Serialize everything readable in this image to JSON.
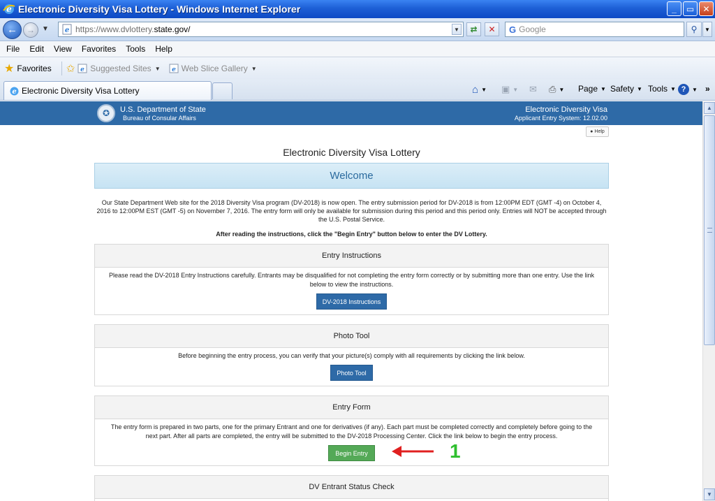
{
  "window": {
    "title": "Electronic Diversity Visa Lottery - Windows Internet Explorer",
    "buttons": {
      "minimize": "_",
      "maximize": "▭",
      "close": "✕"
    }
  },
  "address": {
    "url_scheme": "https://www.dvlottery.",
    "url_host": "state.gov/",
    "search_placeholder": "Google"
  },
  "menu": [
    "File",
    "Edit",
    "View",
    "Favorites",
    "Tools",
    "Help"
  ],
  "favorites": {
    "label": "Favorites",
    "links": [
      "Suggested Sites",
      "Web Slice Gallery"
    ]
  },
  "tabs": {
    "active_label": "Electronic Diversity Visa Lottery"
  },
  "commands": {
    "page": "Page",
    "safety": "Safety",
    "tools": "Tools",
    "more": "»"
  },
  "site": {
    "dept": "U.S. Department of State",
    "bureau": "Bureau of Consular Affairs",
    "system": "Electronic Diversity Visa",
    "system_version": "Applicant Entry System: 12.02.00",
    "help_label": "Help",
    "page_title": "Electronic Diversity Visa Lottery",
    "welcome": "Welcome",
    "intro": "Our State Department Web site for the 2018 Diversity Visa program (DV-2018) is now open. The entry submission period for DV-2018 is from 12:00PM EDT (GMT -4) on October 4, 2016 to 12:00PM EST (GMT -5) on November 7, 2016. The entry form will only be available for submission during this period and this period only. Entries will NOT be accepted through the U.S. Postal Service.",
    "intro_bold": "After reading the instructions, click the \"Begin Entry\" button below to enter the DV Lottery."
  },
  "panels": {
    "instructions": {
      "title": "Entry Instructions",
      "body": "Please read the DV-2018 Entry Instructions carefully. Entrants may be disqualified for not completing the entry form correctly or by submitting more than one entry. Use the link below to view the instructions.",
      "button": "DV-2018 Instructions"
    },
    "photo": {
      "title": "Photo Tool",
      "body": "Before beginning the entry process, you can verify that your picture(s) comply with all requirements by clicking the link below.",
      "button": "Photo Tool"
    },
    "entry": {
      "title": "Entry Form",
      "body": "The entry form is prepared in two parts, one for the primary Entrant and one for derivatives (if any). Each part must be completed correctly and completely before going to the next part. After all parts are completed, the entry will be submitted to the DV-2018 Processing Center. Click the link below to begin the entry process.",
      "button": "Begin Entry"
    },
    "status": {
      "title": "DV Entrant Status Check"
    }
  },
  "annotation": {
    "number": "1",
    "arrow_color": "#e02020",
    "number_color": "#2fbf2f"
  },
  "colors": {
    "header_blue": "#2e6aa7",
    "button_green": "#54a957"
  }
}
